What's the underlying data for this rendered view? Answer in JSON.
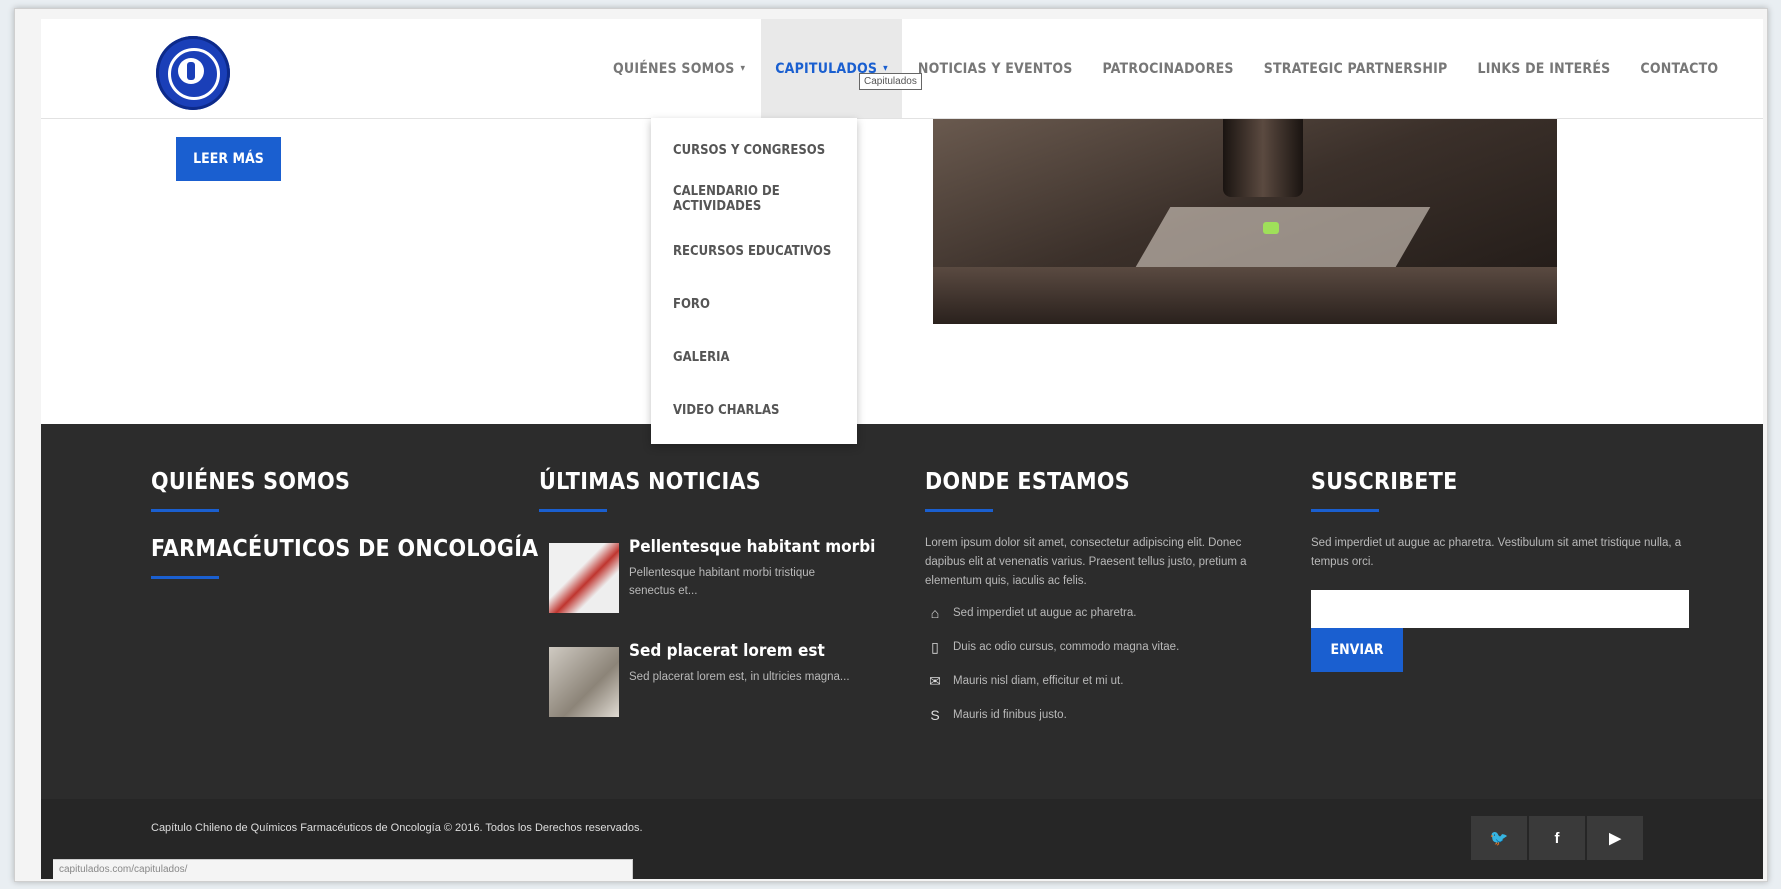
{
  "header": {
    "nav": [
      {
        "label": "QUIÉNES SOMOS",
        "caret": "▾"
      },
      {
        "label": "CAPITULADOS",
        "caret": "▾"
      },
      {
        "label": "NOTICIAS Y EVENTOS"
      },
      {
        "label": "PATROCINADORES"
      },
      {
        "label": "STRATEGIC PARTNERSHIP"
      },
      {
        "label": "LINKS DE INTERÉS"
      },
      {
        "label": "CONTACTO"
      }
    ],
    "tooltip": "Capitulados"
  },
  "dropdown": {
    "items": [
      "CURSOS Y CONGRESOS",
      "CALENDARIO DE ACTIVIDADES",
      "RECURSOS EDUCATIVOS",
      "FORO",
      "GALERIA",
      "VIDEO CHARLAS"
    ]
  },
  "content": {
    "read_more": "LEER MÁS"
  },
  "footer": {
    "about": {
      "title": "QUIÉNES SOMOS",
      "subtitle": "FARMACÉUTICOS DE ONCOLOGÍA"
    },
    "news": {
      "title": "ÚLTIMAS NOTICIAS",
      "items": [
        {
          "title": "Pellentesque habitant morbi",
          "excerpt": "Pellentesque habitant morbi tristique senectus et..."
        },
        {
          "title": "Sed placerat lorem est",
          "excerpt": "Sed placerat lorem est, in ultricies magna..."
        }
      ]
    },
    "location": {
      "title": "DONDE ESTAMOS",
      "text": "Lorem ipsum dolor sit amet, consectetur adipiscing elit. Donec dapibus elit at venenatis varius. Praesent tellus justo, pretium a elementum quis, iaculis ac felis.",
      "contacts": [
        {
          "icon": "home-icon",
          "glyph": "⌂",
          "text": "Sed imperdiet ut augue ac pharetra."
        },
        {
          "icon": "mobile-icon",
          "glyph": "▯",
          "text": "Duis ac odio cursus, commodo magna vitae."
        },
        {
          "icon": "envelope-icon",
          "glyph": "✉",
          "text": "Mauris nisl diam, efficitur et mi ut."
        },
        {
          "icon": "skype-icon",
          "glyph": "S",
          "text": "Mauris id finibus justo."
        }
      ]
    },
    "subscribe": {
      "title": "SUSCRIBETE",
      "text": "Sed imperdiet ut augue ac pharetra. Vestibulum sit amet tristique nulla, a tempus orci.",
      "input_value": "",
      "button": "ENVIAR"
    },
    "copyright": "Capítulo Chileno de Químicos Farmacéuticos de Oncología © 2016. Todos los Derechos reservados.",
    "social": [
      {
        "icon": "twitter-icon",
        "glyph": "🐦"
      },
      {
        "icon": "facebook-icon",
        "glyph": "f"
      },
      {
        "icon": "youtube-icon",
        "glyph": "▶"
      }
    ]
  },
  "status_bar": {
    "url": "capitulados.com/capitulados/"
  },
  "colors": {
    "accent": "#1a5fd0",
    "footer_bg": "#2c2c2c",
    "bottom_bar_bg": "#262626"
  }
}
